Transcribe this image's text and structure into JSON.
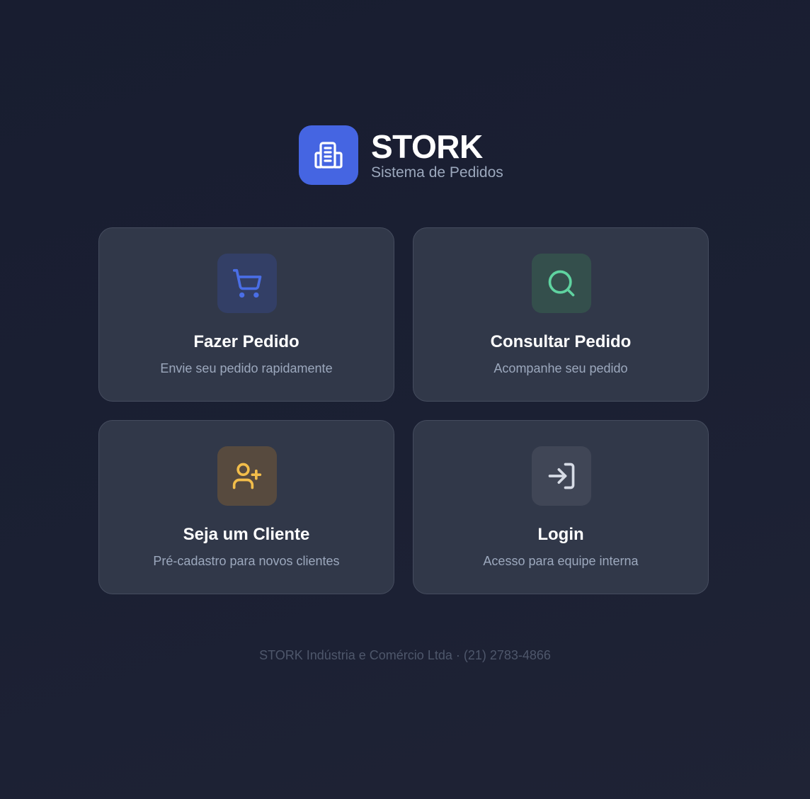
{
  "brand": {
    "title": "STORK",
    "subtitle": "Sistema de Pedidos",
    "logo_icon": "building-icon",
    "accent_color": "#4565e2"
  },
  "cards": [
    {
      "title": "Fazer Pedido",
      "description": "Envie seu pedido rapidamente",
      "icon": "shopping-cart-icon",
      "icon_color": "#4a6ee6",
      "icon_bg": "#333f66"
    },
    {
      "title": "Consultar Pedido",
      "description": "Acompanhe seu pedido",
      "icon": "search-icon",
      "icon_color": "#5fd3a0",
      "icon_bg": "#344f4c"
    },
    {
      "title": "Seja um Cliente",
      "description": "Pré-cadastro para novos clientes",
      "icon": "user-plus-icon",
      "icon_color": "#f2bd4a",
      "icon_bg": "#574a3e"
    },
    {
      "title": "Login",
      "description": "Acesso para equipe interna",
      "icon": "log-in-icon",
      "icon_color": "#d7dce6",
      "icon_bg": "#404656"
    }
  ],
  "footer": {
    "text": "STORK Indústria e Comércio Ltda · (21) 2783-4866"
  }
}
